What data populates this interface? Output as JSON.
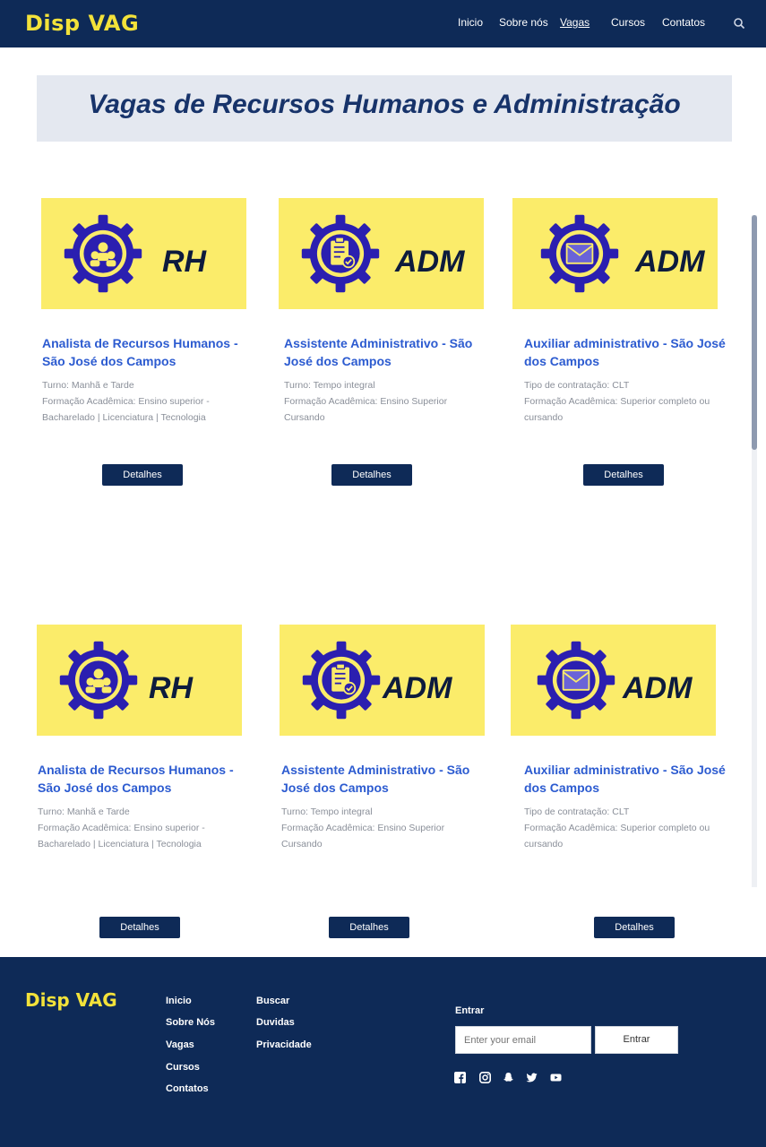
{
  "brand": {
    "logo_text": "Disp VAG"
  },
  "nav": {
    "items": [
      {
        "label": "Inicio"
      },
      {
        "label": "Sobre nós"
      },
      {
        "label": "Vagas"
      },
      {
        "label": "Cursos"
      },
      {
        "label": "Contatos"
      }
    ],
    "active": "Vagas",
    "search_icon": "search-icon"
  },
  "banner": {
    "title": "Vagas de Recursos Humanos e Administração"
  },
  "colors": {
    "navy": "#0e2a57",
    "yellow": "#fbec6a",
    "link_blue": "#2c5bd0",
    "gear_blue": "#2b1fb0"
  },
  "cards": [
    {
      "tag": "RH",
      "icon": "people-gear-icon",
      "title": "Analista de Recursos Humanos - São José dos Campos",
      "line1": "Turno: Manhã e Tarde",
      "line2": "Formação Acadêmica:  Ensino superior -",
      "line3": "Bacharelado | Licenciatura | Tecnologia",
      "button": "Detalhes"
    },
    {
      "tag": "ADM",
      "icon": "clipboard-gear-icon",
      "title": "Assistente Administrativo - São José dos Campos",
      "line1": "Turno: Tempo integral",
      "line2": "Formação Acadêmica: Ensino Superior",
      "line3": "Cursando",
      "button": "Detalhes"
    },
    {
      "tag": "ADM",
      "icon": "mail-gear-icon",
      "title": "Auxiliar administrativo - São José dos Campos",
      "line1": "Tipo de contratação: CLT",
      "line2": "Formação Acadêmica: Superior completo ou",
      "line3": "cursando",
      "button": "Detalhes"
    },
    {
      "tag": "RH",
      "icon": "people-gear-icon",
      "title": "Analista de Recursos Humanos - São José dos Campos",
      "line1": "Turno: Manhã e Tarde",
      "line2": "Formação Acadêmica:  Ensino superior -",
      "line3": "Bacharelado | Licenciatura | Tecnologia",
      "button": "Detalhes"
    },
    {
      "tag": "ADM",
      "icon": "clipboard-gear-icon",
      "title": "Assistente Administrativo - São José dos Campos",
      "line1": "Turno: Tempo integral",
      "line2": "Formação Acadêmica: Ensino Superior",
      "line3": "Cursando",
      "button": "Detalhes"
    },
    {
      "tag": "ADM",
      "icon": "mail-gear-icon",
      "title": "Auxiliar administrativo - São José dos Campos",
      "line1": "Tipo de contratação: CLT",
      "line2": "Formação Acadêmica: Superior completo ou",
      "line3": "cursando",
      "button": "Detalhes"
    }
  ],
  "footer": {
    "logo_text": "Disp VAG",
    "col1": [
      "Inicio",
      "Sobre Nós",
      "Vagas",
      "Cursos",
      "Contatos"
    ],
    "col2": [
      "Buscar",
      "Duvidas",
      "Privacidade"
    ],
    "entrar_label": "Entrar",
    "email_placeholder": "Enter your email",
    "entrar_button": "Entrar",
    "social_icons": [
      "facebook-icon",
      "instagram-icon",
      "snapchat-icon",
      "twitter-icon",
      "youtube-icon"
    ]
  }
}
